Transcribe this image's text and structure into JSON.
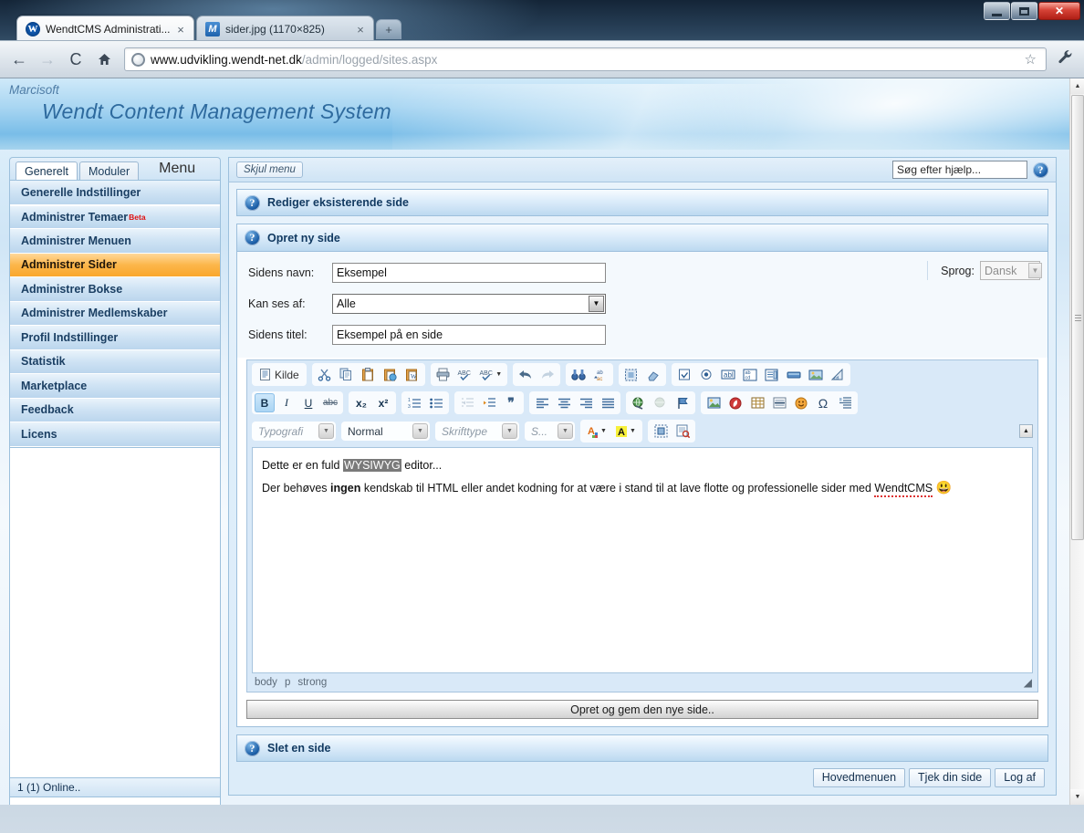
{
  "browser": {
    "tabs": [
      {
        "title": "WendtCMS Administrati...",
        "favicon": "wendt-w-icon",
        "active": true
      },
      {
        "title": "sider.jpg (1170×825)",
        "favicon": "image-m-icon",
        "active": false
      }
    ],
    "new_tab_label": "+",
    "close_label": "×",
    "nav": {
      "back": "←",
      "forward": "→",
      "reload": "C",
      "home": "⌂"
    },
    "url_host": "www.udvikling.wendt-net.dk",
    "url_path": "/admin/logged/sites.aspx",
    "star_icon": "☆",
    "wrench_icon": "🔧",
    "window_controls": {
      "minimize": "minimize",
      "maximize": "maximize",
      "close": "✕"
    }
  },
  "site": {
    "brand_sub": "Marcisoft",
    "brand_title": "Wendt Content Management System"
  },
  "menu": {
    "tabs": [
      {
        "label": "Generelt",
        "active": true
      },
      {
        "label": "Moduler",
        "active": false
      }
    ],
    "heading": "Menu",
    "items": [
      {
        "label": "Generelle Indstillinger",
        "active": false,
        "badge": ""
      },
      {
        "label": "Administrer Temaer",
        "active": false,
        "badge": "Beta"
      },
      {
        "label": "Administrer Menuen",
        "active": false,
        "badge": ""
      },
      {
        "label": "Administrer Sider",
        "active": true,
        "badge": ""
      },
      {
        "label": "Administrer Bokse",
        "active": false,
        "badge": ""
      },
      {
        "label": "Administrer Medlemskaber",
        "active": false,
        "badge": ""
      },
      {
        "label": "Profil Indstillinger",
        "active": false,
        "badge": ""
      },
      {
        "label": "Statistik",
        "active": false,
        "badge": ""
      },
      {
        "label": "Marketplace",
        "active": false,
        "badge": ""
      },
      {
        "label": "Feedback",
        "active": false,
        "badge": ""
      },
      {
        "label": "Licens",
        "active": false,
        "badge": ""
      }
    ]
  },
  "content_top": {
    "hide_menu_label": "Skjul menu",
    "help_search_value": "Søg efter hjælp...",
    "help_icon": "?"
  },
  "panels": {
    "edit_existing": {
      "title": "Rediger eksisterende side",
      "icon": "?"
    },
    "create_new": {
      "title": "Opret ny side",
      "icon": "?"
    },
    "delete_page": {
      "title": "Slet en side",
      "icon": "?"
    }
  },
  "form": {
    "name_label": "Sidens navn:",
    "name_value": "Eksempel",
    "visibility_label": "Kan ses af:",
    "visibility_value": "Alle",
    "title_label": "Sidens titel:",
    "title_value": "Eksempel på en side",
    "language_label": "Sprog:",
    "language_value": "Dansk"
  },
  "editor": {
    "source_button": "Kilde",
    "row1_groups": [
      {
        "buttons": [
          {
            "name": "source-button",
            "label": "Kilde"
          }
        ]
      },
      {
        "buttons": [
          {
            "name": "cut-icon"
          },
          {
            "name": "copy-icon"
          },
          {
            "name": "paste-icon"
          },
          {
            "name": "paste-text-icon"
          },
          {
            "name": "paste-word-icon"
          }
        ]
      },
      {
        "buttons": [
          {
            "name": "print-icon"
          },
          {
            "name": "spellcheck-icon"
          },
          {
            "name": "spellcheck-options-icon"
          }
        ]
      },
      {
        "buttons": [
          {
            "name": "undo-icon"
          },
          {
            "name": "redo-icon"
          }
        ]
      },
      {
        "buttons": [
          {
            "name": "find-icon"
          },
          {
            "name": "replace-icon"
          }
        ]
      },
      {
        "buttons": [
          {
            "name": "select-all-icon"
          },
          {
            "name": "remove-format-icon"
          }
        ]
      },
      {
        "buttons": [
          {
            "name": "checkbox-field-icon"
          },
          {
            "name": "radio-field-icon"
          },
          {
            "name": "text-field-icon"
          },
          {
            "name": "textarea-icon"
          },
          {
            "name": "select-field-icon"
          },
          {
            "name": "button-field-icon"
          },
          {
            "name": "image-button-icon"
          },
          {
            "name": "hidden-field-icon"
          }
        ]
      }
    ],
    "row2_groups": [
      {
        "buttons": [
          {
            "name": "bold-icon",
            "label": "B",
            "active": true
          },
          {
            "name": "italic-icon",
            "label": "I"
          },
          {
            "name": "underline-icon",
            "label": "U"
          },
          {
            "name": "strike-icon",
            "label": "abc"
          }
        ]
      },
      {
        "buttons": [
          {
            "name": "subscript-icon",
            "label": "x₂"
          },
          {
            "name": "superscript-icon",
            "label": "x²"
          }
        ]
      },
      {
        "buttons": [
          {
            "name": "numbered-list-icon"
          },
          {
            "name": "bulleted-list-icon"
          }
        ]
      },
      {
        "buttons": [
          {
            "name": "outdent-icon",
            "disabled": true
          },
          {
            "name": "indent-icon"
          },
          {
            "name": "blockquote-icon",
            "label": "❞"
          }
        ]
      },
      {
        "buttons": [
          {
            "name": "align-left-icon"
          },
          {
            "name": "align-center-icon"
          },
          {
            "name": "align-right-icon"
          },
          {
            "name": "align-justify-icon"
          }
        ]
      },
      {
        "buttons": [
          {
            "name": "link-icon"
          },
          {
            "name": "unlink-icon",
            "disabled": true
          },
          {
            "name": "anchor-icon"
          }
        ]
      },
      {
        "buttons": [
          {
            "name": "image-icon"
          },
          {
            "name": "flash-icon"
          },
          {
            "name": "table-icon"
          },
          {
            "name": "horizontal-rule-icon"
          },
          {
            "name": "smiley-icon"
          },
          {
            "name": "special-char-icon",
            "label": "Ω"
          },
          {
            "name": "page-break-icon"
          }
        ]
      }
    ],
    "selects": [
      {
        "name": "styles-select",
        "value": "Typografi",
        "placeholder": true
      },
      {
        "name": "format-select",
        "value": "Normal",
        "placeholder": false
      },
      {
        "name": "font-select",
        "value": "Skrifttype",
        "placeholder": true
      },
      {
        "name": "fontsize-select",
        "value": "S...",
        "placeholder": true
      }
    ],
    "color_buttons": [
      {
        "name": "text-color-icon",
        "label": "A"
      },
      {
        "name": "background-color-icon",
        "label": "A"
      }
    ],
    "extra_buttons": [
      {
        "name": "show-blocks-icon"
      },
      {
        "name": "templates-icon"
      }
    ],
    "collapse_icon": "▲",
    "content": {
      "line1_pre": "Dette er en fuld ",
      "line1_highlight": "WYSIWYG",
      "line1_post": " editor...",
      "line2_pre": "Der behøves ",
      "line2_bold": "ingen",
      "line2_mid": " kendskab til HTML eller andet kodning for at være i stand til at lave flotte og professionelle sider med ",
      "line2_spell": "WendtCMS",
      "line2_emoji": "😃"
    },
    "path": [
      "body",
      "p",
      "strong"
    ],
    "resize_grip": "◢"
  },
  "actions": {
    "save_label": "Opret og gem den nye side..",
    "footer_buttons": [
      "Hovedmenuen",
      "Tjek din side",
      "Log af"
    ]
  },
  "status": {
    "online_text": "1 (1) Online.."
  },
  "scrollbar": {
    "up": "▲",
    "down": "▼"
  }
}
